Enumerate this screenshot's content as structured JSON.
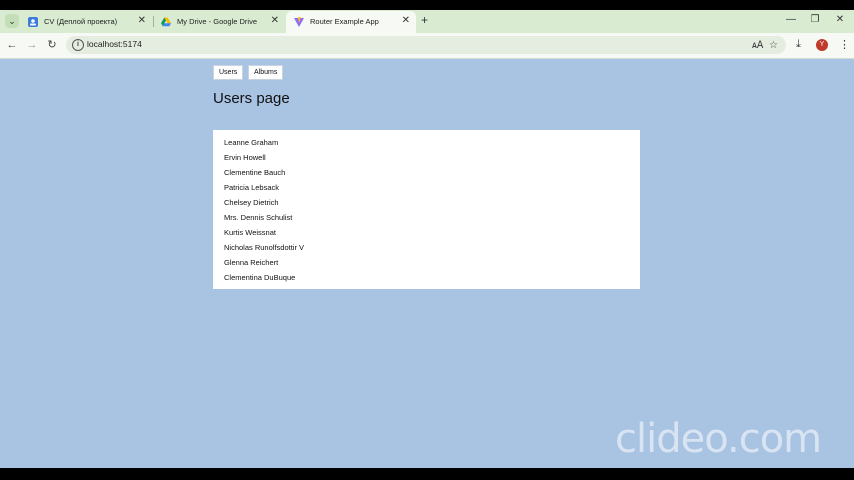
{
  "browser": {
    "tabs": [
      {
        "title": "CV (Деплой проекта)",
        "active": false
      },
      {
        "title": "My Drive - Google Drive",
        "active": false
      },
      {
        "title": "Router Example App",
        "active": true
      }
    ],
    "url": "localhost:5174",
    "avatar_initial": "Y"
  },
  "page": {
    "nav": [
      "Users",
      "Albums"
    ],
    "title": "Users page",
    "users": [
      "Leanne Graham",
      "Ervin Howell",
      "Clementine Bauch",
      "Patricia Lebsack",
      "Chelsey Dietrich",
      "Mrs. Dennis Schulist",
      "Kurtis Weissnat",
      "Nicholas Runolfsdottir V",
      "Glenna Reichert",
      "Clementina DuBuque"
    ]
  },
  "watermark": "clideo.com"
}
